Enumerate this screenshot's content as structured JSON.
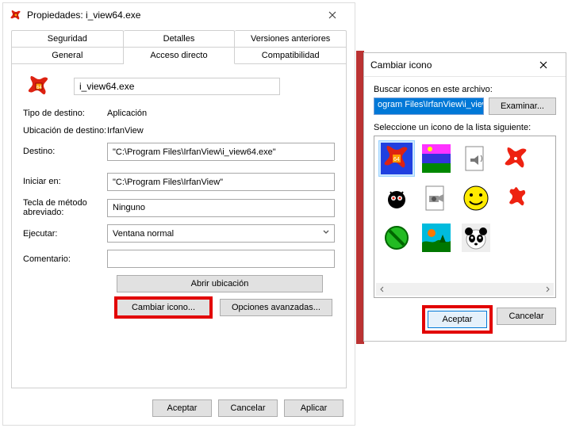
{
  "props": {
    "title": "Propiedades: i_view64.exe",
    "tabs_row1": [
      "Seguridad",
      "Detalles",
      "Versiones anteriores"
    ],
    "tabs_row2": [
      "General",
      "Acceso directo",
      "Compatibilidad"
    ],
    "active_tab": "Acceso directo",
    "file_name": "i_view64.exe",
    "labels": {
      "target_type": "Tipo de destino:",
      "target_loc": "Ubicación de destino:",
      "target": "Destino:",
      "start_in": "Iniciar en:",
      "hotkey": "Tecla de método abreviado:",
      "run": "Ejecutar:",
      "comment": "Comentario:"
    },
    "values": {
      "target_type": "Aplicación",
      "target_loc": "IrfanView",
      "target": "\"C:\\Program Files\\IrfanView\\i_view64.exe\"",
      "start_in": "\"C:\\Program Files\\IrfanView\"",
      "hotkey": "Ninguno",
      "run": "Ventana normal",
      "comment": ""
    },
    "buttons": {
      "open_location": "Abrir ubicación",
      "change_icon": "Cambiar icono...",
      "advanced": "Opciones avanzadas..."
    },
    "footer": {
      "ok": "Aceptar",
      "cancel": "Cancelar",
      "apply": "Aplicar"
    }
  },
  "iconwin": {
    "title": "Cambiar icono",
    "label_search": "Buscar iconos en este archivo:",
    "path": "ogram Files\\IrfanView\\i_view64.exe",
    "browse": "Examinar...",
    "label_select": "Seleccione un icono de la lista siguiente:",
    "ok": "Aceptar",
    "cancel": "Cancelar",
    "icons": [
      "irfanview-main",
      "rainbow",
      "audio-doc",
      "red-splat",
      "bw-cat",
      "camera-doc",
      "smiley",
      "red-blob",
      "no-entry",
      "sunset",
      "panda"
    ],
    "selected_index": 0
  }
}
